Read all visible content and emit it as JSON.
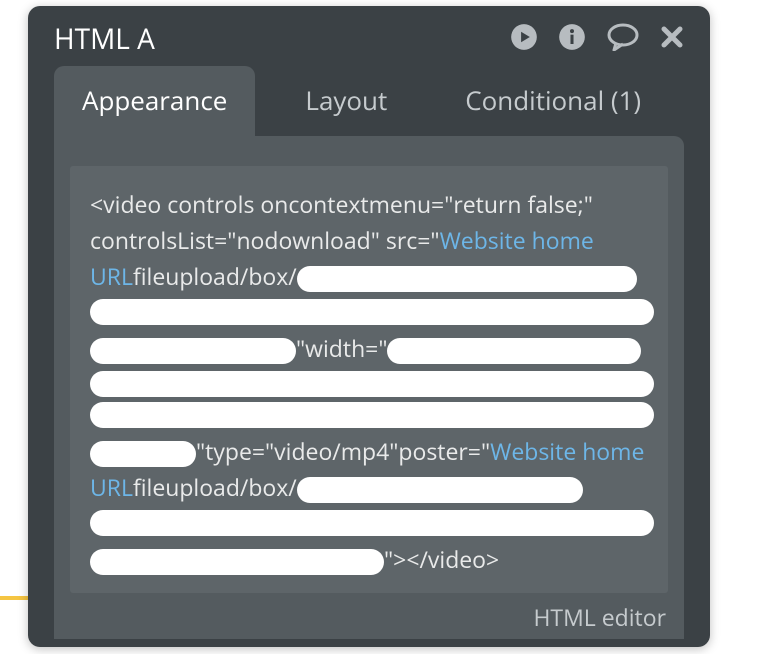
{
  "panel": {
    "title": "HTML A"
  },
  "tabs": {
    "appearance": "Appearance",
    "layout": "Layout",
    "conditional": "Conditional (1)",
    "active": "appearance"
  },
  "code": {
    "seg1": "<video controls oncontextmenu=\"return false;\" controlsList=\"nodownload\" src=\"",
    "dyn1": "Website home URL",
    "seg2": "fileupload/box/",
    "seg3": "\"width=\"",
    "seg4": "\"type=\"video/mp4\"poster=\"",
    "dyn2": "Website home URL",
    "seg5": "fileupload/box/",
    "seg6": "\"></video>"
  },
  "footer": {
    "editor_link": "HTML editor"
  }
}
